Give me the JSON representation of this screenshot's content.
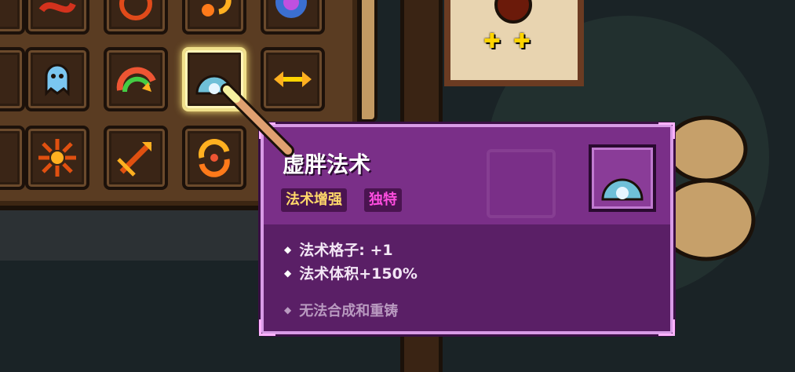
{
  "spell": {
    "title": "虚胖法术",
    "tags": [
      "法术增强",
      "独特"
    ],
    "stats": [
      "法术格子: +1",
      "法术体积+150%"
    ],
    "note": "无法合成和重铸"
  },
  "hud": {
    "plus_a": "✚",
    "plus_b": "✚"
  },
  "icons": {
    "grid": [
      "red-swirl-icon",
      "red-ring-icon",
      "orange-cycle-icon",
      "galaxy-icon",
      "ghost-icon",
      "rainbow-arc-icon",
      "bubble-orb-icon",
      "arrows-icon",
      "burst-icon",
      "split-arrow-icon",
      "orange-cycle2-icon"
    ],
    "selected": "bubble-orb-icon"
  },
  "colors": {
    "tooltip_bg": "#6a2778",
    "tooltip_border": "#d89be6",
    "tag_yellow": "#ffd86a",
    "tag_pink": "#ff4de0"
  }
}
